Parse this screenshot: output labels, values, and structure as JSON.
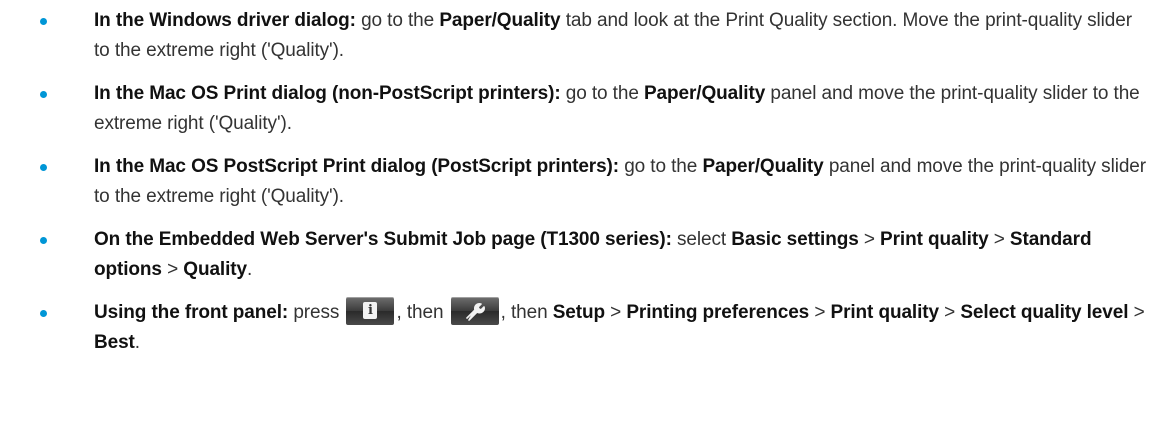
{
  "items": [
    {
      "lead": "In the Windows driver dialog:",
      "t1": " go to the ",
      "b1": "Paper/Quality",
      "t2": " tab and look at the Print Quality section. Move the print-quality slider to the extreme right ('Quality')."
    },
    {
      "lead": "In the Mac OS Print dialog (non-PostScript printers):",
      "t1": " go to the ",
      "b1": "Paper/Quality",
      "t2": " panel and move the print-quality slider to the extreme right ('Quality')."
    },
    {
      "lead": "In the Mac OS PostScript Print dialog (PostScript printers):",
      "t1": " go to the ",
      "b1": "Paper/Quality",
      "t2": " panel and move the print-quality slider to the extreme right ('Quality')."
    },
    {
      "lead": "On the Embedded Web Server's Submit Job page (T1300 series):",
      "t1": " select ",
      "b1": "Basic settings",
      "sep1": " > ",
      "b2": "Print quality",
      "sep2": " > ",
      "b3": "Standard options",
      "sep3": " > ",
      "b4": "Quality",
      "end": "."
    },
    {
      "lead": "Using the front panel:",
      "t1": " press ",
      "icon1": "info-icon",
      "t2": ", then ",
      "icon2": "wrench-icon",
      "t3": ", then ",
      "b1": "Setup",
      "sep1": " > ",
      "b2": "Printing preferences",
      "sep2": " > ",
      "b3": "Print quality",
      "sep3": " > ",
      "b4": "Select quality level",
      "sep4": " > ",
      "b5": "Best",
      "end": "."
    }
  ],
  "colors": {
    "bullet": "#0096d6",
    "text": "#333333",
    "emphasis": "#111111"
  }
}
